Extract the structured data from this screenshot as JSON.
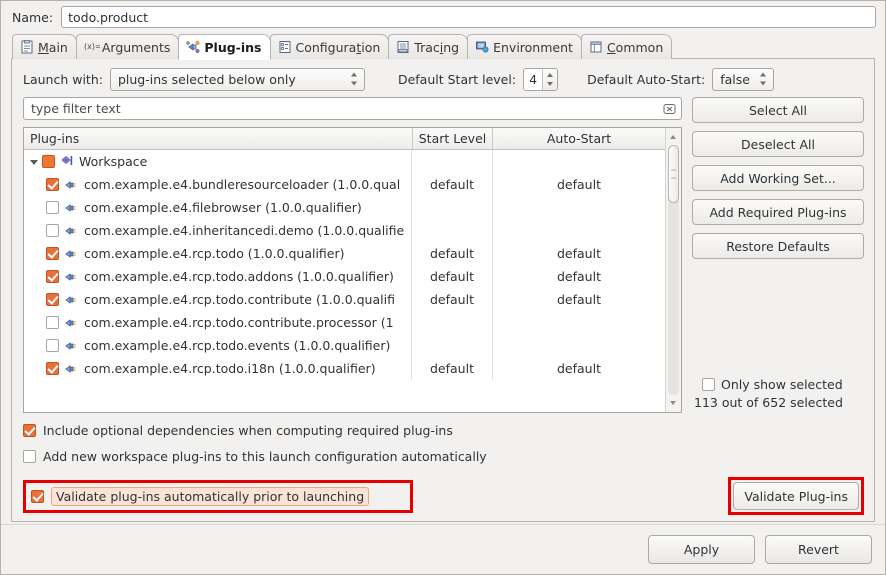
{
  "name_row": {
    "label": "Name:",
    "value": "todo.product"
  },
  "tabs": [
    {
      "label": "Main",
      "icon": "main-tab-icon",
      "active": false
    },
    {
      "label": "Arguments",
      "icon": "arguments-tab-icon",
      "active": false
    },
    {
      "label": "Plug-ins",
      "icon": "plugins-tab-icon",
      "active": true
    },
    {
      "label": "Configuration",
      "icon": "configuration-tab-icon",
      "active": false
    },
    {
      "label": "Tracing",
      "icon": "tracing-tab-icon",
      "active": false
    },
    {
      "label": "Environment",
      "icon": "environment-tab-icon",
      "active": false
    },
    {
      "label": "Common",
      "icon": "common-tab-icon",
      "active": false
    }
  ],
  "launch_row": {
    "launch_with_label": "Launch with:",
    "launch_with_value": "plug-ins selected below only",
    "start_level_label": "Default Start level:",
    "start_level_value": "4",
    "auto_start_label": "Default Auto-Start:",
    "auto_start_value": "false"
  },
  "filter": {
    "placeholder": "type filter text",
    "value": "type filter text",
    "clear_icon": "clear-filter-icon"
  },
  "table": {
    "columns": [
      "Plug-ins",
      "Start Level",
      "Auto-Start"
    ],
    "rows": [
      {
        "name": "Workspace",
        "type": "group",
        "check": "partial",
        "icon": "workspace-icon",
        "start_level": "",
        "auto_start": ""
      },
      {
        "name": "com.example.e4.bundleresourceloader (1.0.0.qual",
        "type": "plugin",
        "check": "checked",
        "icon": "plugin-icon",
        "start_level": "default",
        "auto_start": "default"
      },
      {
        "name": "com.example.e4.filebrowser (1.0.0.qualifier)",
        "type": "plugin",
        "check": "unchecked",
        "icon": "plugin-icon",
        "start_level": "",
        "auto_start": ""
      },
      {
        "name": "com.example.e4.inheritancedi.demo (1.0.0.qualifie",
        "type": "plugin",
        "check": "unchecked",
        "icon": "plugin-icon",
        "start_level": "",
        "auto_start": ""
      },
      {
        "name": "com.example.e4.rcp.todo (1.0.0.qualifier)",
        "type": "plugin",
        "check": "checked",
        "icon": "plugin-icon",
        "start_level": "default",
        "auto_start": "default"
      },
      {
        "name": "com.example.e4.rcp.todo.addons (1.0.0.qualifier)",
        "type": "plugin",
        "check": "checked",
        "icon": "plugin-icon",
        "start_level": "default",
        "auto_start": "default"
      },
      {
        "name": "com.example.e4.rcp.todo.contribute (1.0.0.qualifi",
        "type": "plugin",
        "check": "checked",
        "icon": "plugin-icon",
        "start_level": "default",
        "auto_start": "default"
      },
      {
        "name": "com.example.e4.rcp.todo.contribute.processor (1",
        "type": "plugin",
        "check": "unchecked",
        "icon": "plugin-icon",
        "start_level": "",
        "auto_start": ""
      },
      {
        "name": "com.example.e4.rcp.todo.events (1.0.0.qualifier)",
        "type": "plugin",
        "check": "unchecked",
        "icon": "plugin-icon",
        "start_level": "",
        "auto_start": ""
      },
      {
        "name": "com.example.e4.rcp.todo.i18n (1.0.0.qualifier)",
        "type": "plugin",
        "check": "checked",
        "icon": "plugin-icon",
        "start_level": "default",
        "auto_start": "default"
      }
    ]
  },
  "side_buttons": [
    "Select All",
    "Deselect All",
    "Add Working Set...",
    "Add Required Plug-ins",
    "Restore Defaults"
  ],
  "only_show_selected": {
    "label": "Only show selected",
    "checked": false
  },
  "selection_count": "113 out of 652 selected",
  "options": {
    "include_optional": {
      "label": "Include optional dependencies when computing required plug-ins",
      "checked": true
    },
    "add_new_workspace": {
      "label": "Add new workspace plug-ins to this launch configuration automatically",
      "checked": false
    },
    "validate_auto": {
      "label": "Validate plug-ins automatically prior to launching",
      "checked": true
    },
    "validate_button": "Validate Plug-ins"
  },
  "footer": {
    "apply": "Apply",
    "revert": "Revert"
  },
  "colors": {
    "highlight_box": "#e60000",
    "checkbox_checked": "#e8703a",
    "focus_label_bg": "#fbe4d6",
    "dialog_bg": "#f2f1f0"
  }
}
